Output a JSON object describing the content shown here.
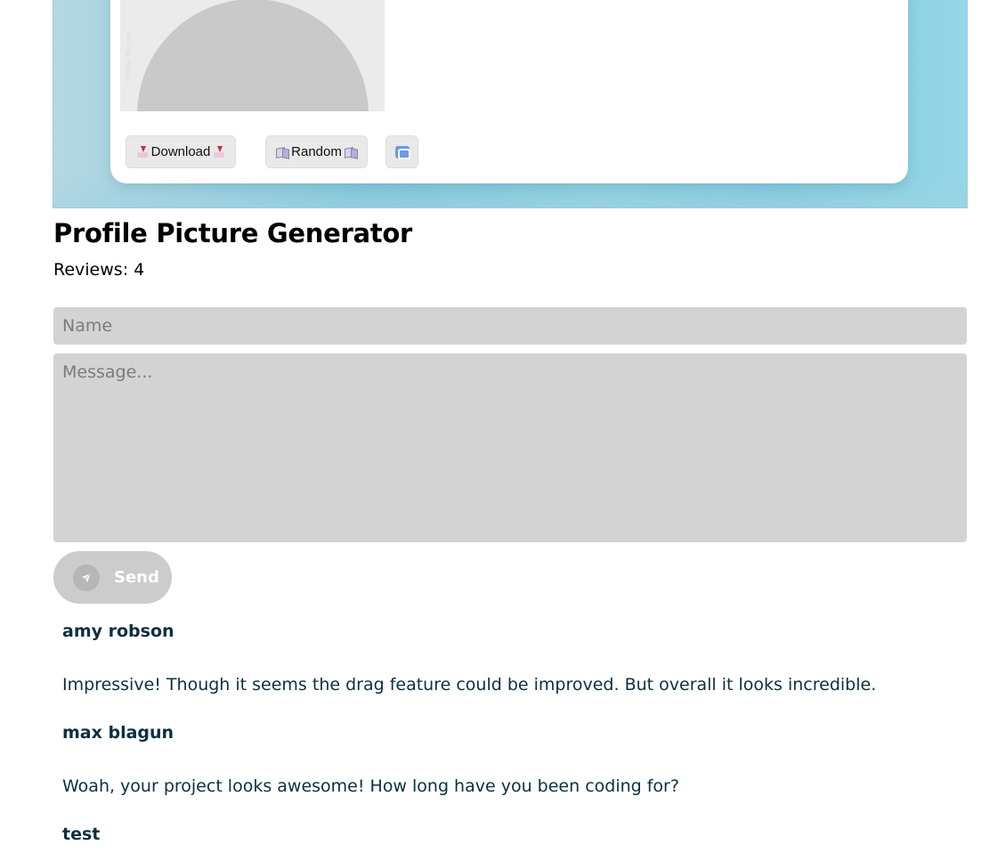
{
  "preview": {
    "watermark": "Profile Picture",
    "buttons": {
      "download_label": "Download",
      "random_label": "Random"
    }
  },
  "page": {
    "title": "Profile Picture Generator",
    "reviews_label": "Reviews: 4"
  },
  "form": {
    "name_placeholder": "Name",
    "name_value": "",
    "message_placeholder": "Message...",
    "message_value": "",
    "send_label": "Send"
  },
  "reviews": [
    {
      "author": "amy robson",
      "text": "Impressive! Though it seems the drag feature could be improved. But overall it looks incredible."
    },
    {
      "author": "max blagun",
      "text": "Woah, your project looks awesome! How long have you been coding for?"
    },
    {
      "author": "test",
      "text": ""
    }
  ],
  "colors": {
    "banner": "#83cbe0",
    "input_bg": "#d3d3d3",
    "send_bg": "#cccccc",
    "review_text": "#0b3040"
  },
  "icons": {
    "download": "inbox-tray-icon",
    "random": "dice-icon",
    "swap": "repeat-icon",
    "send": "paper-plane-icon"
  }
}
